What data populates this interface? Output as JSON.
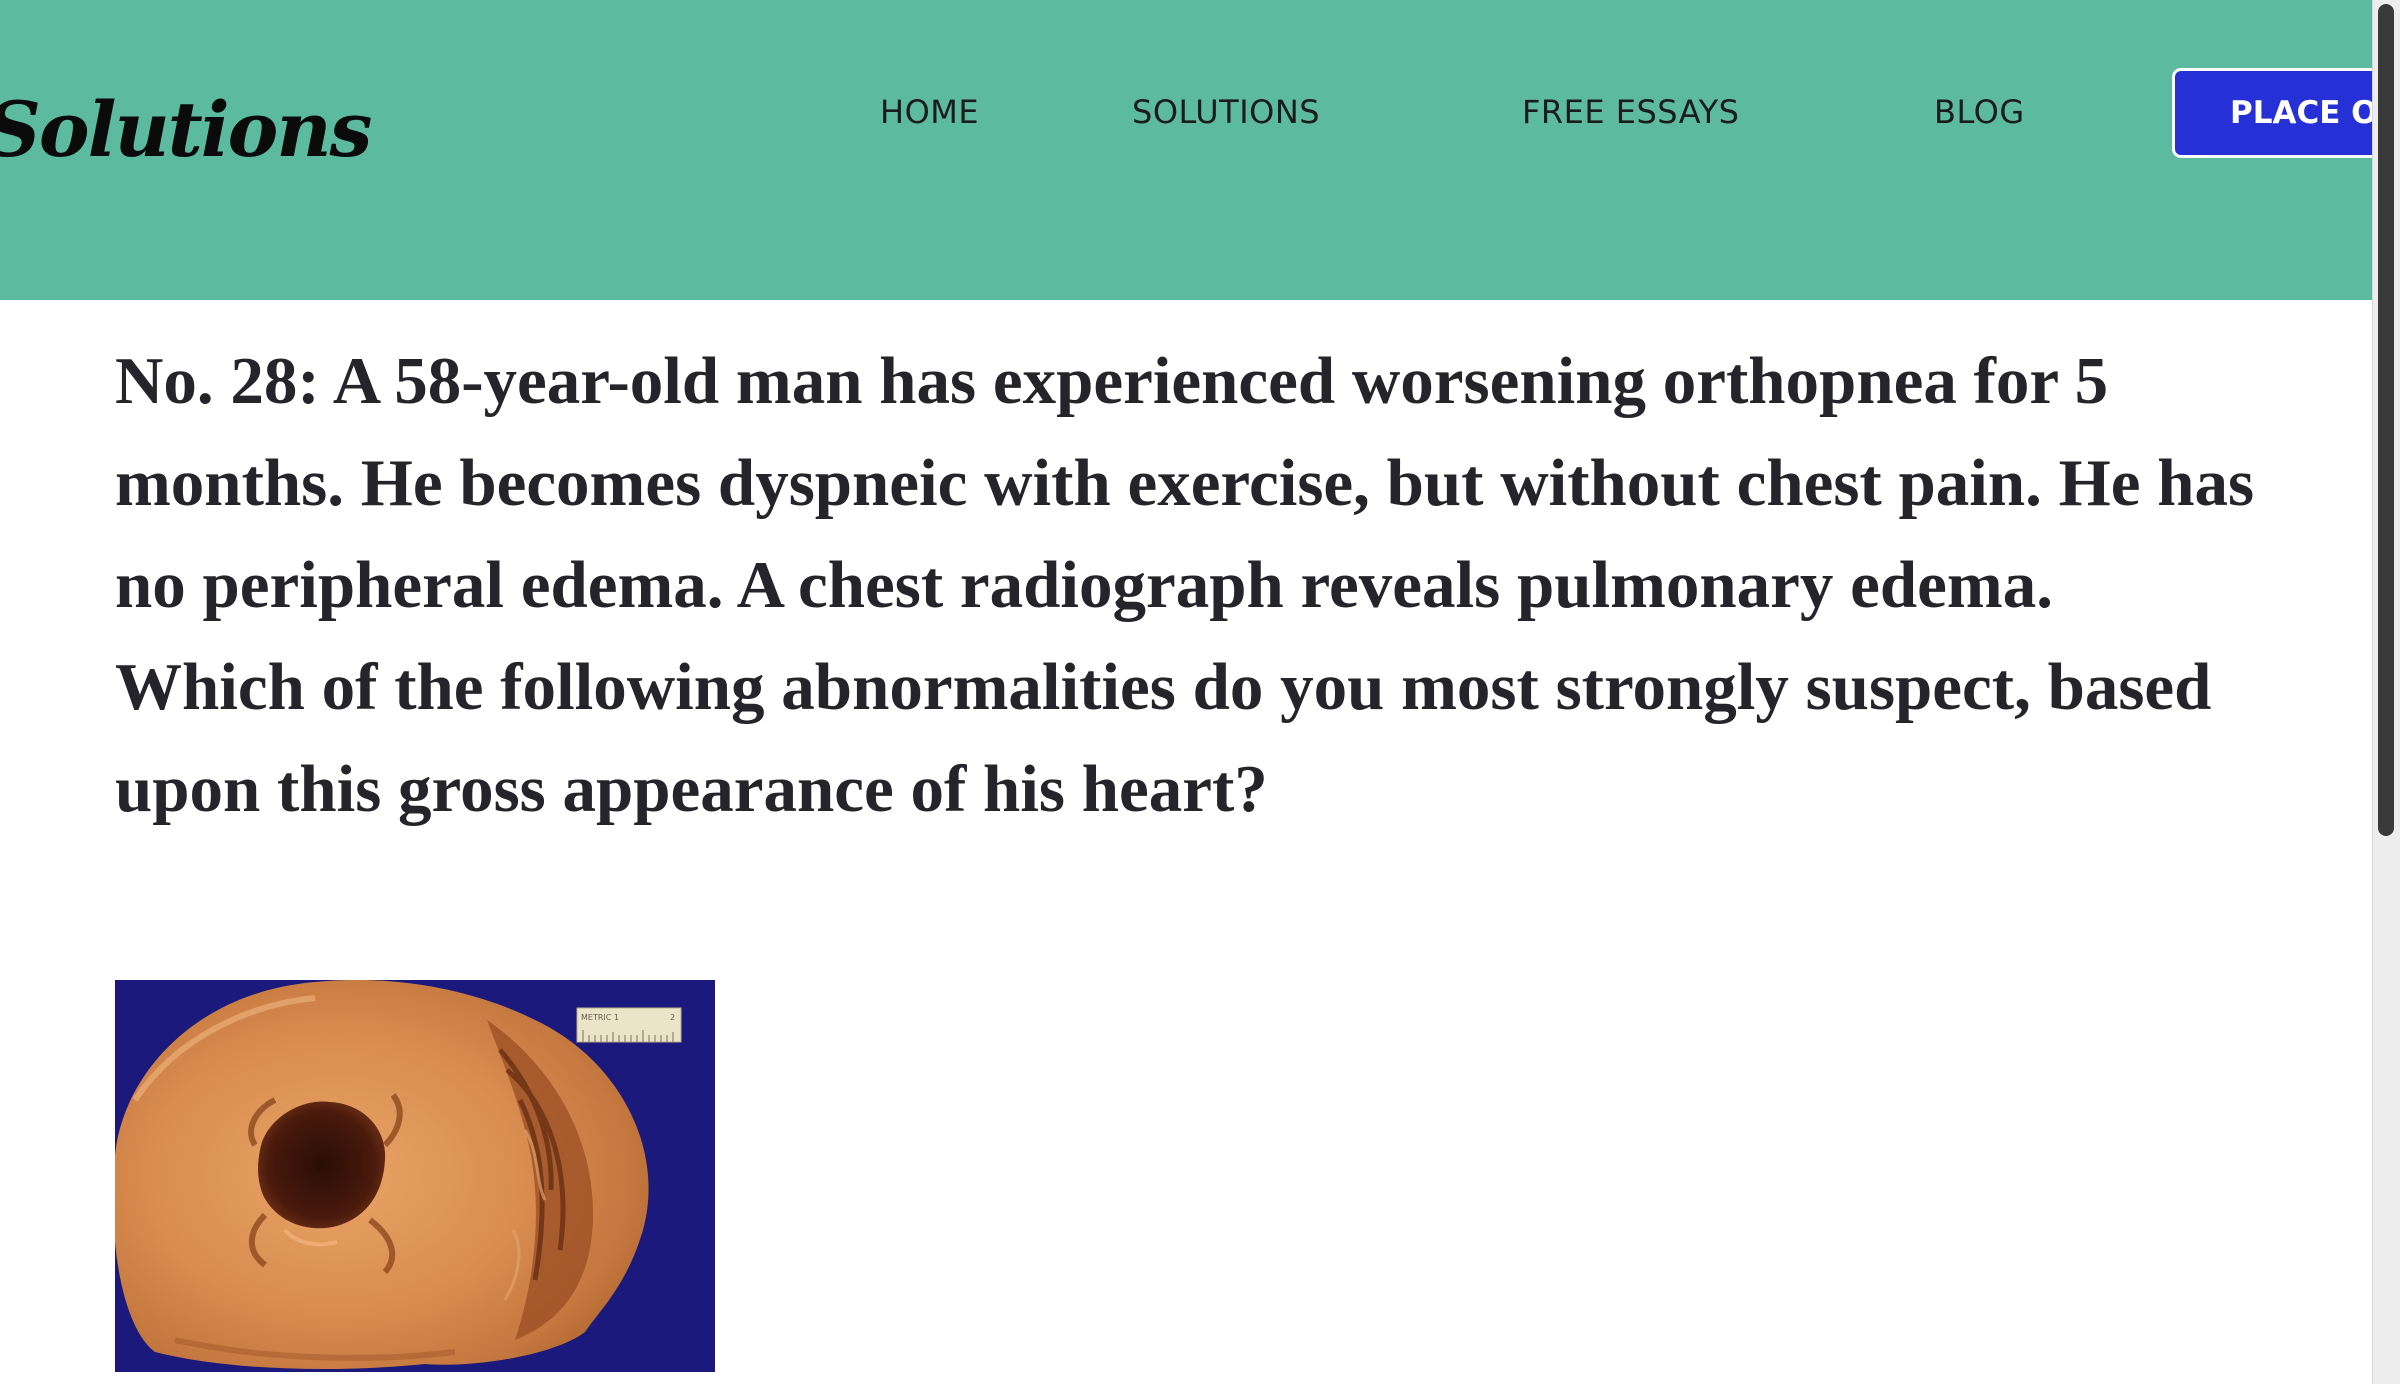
{
  "header": {
    "logo_text": "Solutions",
    "nav": {
      "home": "HOME",
      "solutions": "SOLUTIONS",
      "free_essays": "FREE ESSAYS",
      "blog": "BLOG"
    },
    "cta_label": "PLACE ORDER",
    "colors": {
      "header_bg": "#5cbb9e",
      "cta_bg": "#2530d6"
    }
  },
  "main": {
    "question_text": "No. 28: A 58-year-old man has experienced worsening orthopnea for 5 months. He becomes dyspneic with exercise, but without chest pain. He has no peripheral edema. A chest radiograph reveals pulmonary edema. Which of the following abnormalities do you most strongly suspect, based upon this gross appearance of his heart?",
    "image": {
      "ruler_label": "METRIC 1",
      "ruler_number": "2"
    }
  }
}
